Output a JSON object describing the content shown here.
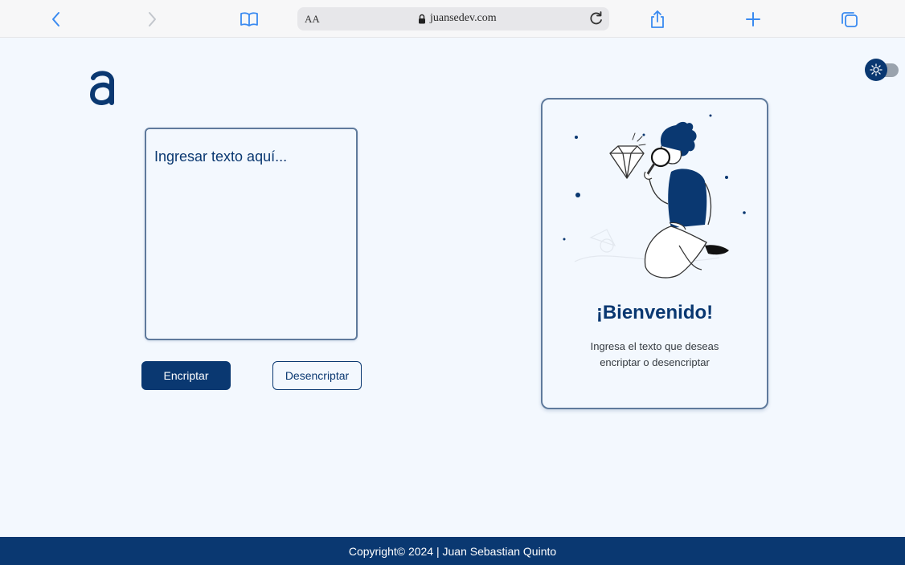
{
  "browser": {
    "address_aa": "AA",
    "url": "juansedev.com"
  },
  "page": {
    "input": {
      "placeholder": "Ingresar texto aquí..."
    },
    "buttons": {
      "encrypt": "Encriptar",
      "decrypt": "Desencriptar"
    },
    "card": {
      "title": "¡Bienvenido!",
      "message": "Ingresa el texto que deseas encriptar o desencriptar"
    },
    "footer": {
      "copyright": "Copyright© 2024 | Juan Sebastian Quinto"
    }
  },
  "colors": {
    "primary": "#0a3871",
    "background": "#f3f8fe",
    "toolbar_icons": "#3a8af0"
  },
  "icons": [
    "back-icon",
    "forward-icon",
    "bookmarks-icon",
    "lock-icon",
    "reload-icon",
    "share-icon",
    "new-tab-icon",
    "tabs-icon",
    "sun-icon",
    "brand-logo"
  ]
}
